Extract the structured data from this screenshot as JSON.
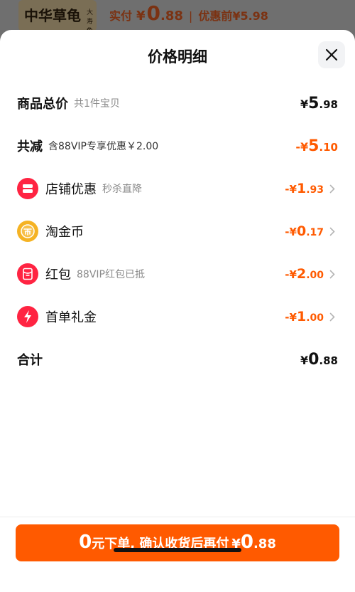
{
  "top_strip": {
    "thumb_title": "中华草龟",
    "thumb_sub": "大寿龟",
    "paid_label": "实付",
    "paid_yen": "¥",
    "paid_int": "0",
    "paid_dec": ".88",
    "separator": "|",
    "before_discount": "优惠前¥5.98"
  },
  "sheet": {
    "title": "价格明细"
  },
  "rows": {
    "total": {
      "label": "商品总价",
      "sub": "共1件宝贝",
      "yen": "¥",
      "int": "5",
      "dec": ".98"
    },
    "reduce": {
      "label": "共减",
      "sub": "含88VIP专享优惠￥2.00",
      "yen": "-¥",
      "int": "5",
      "dec": ".10"
    },
    "shop": {
      "label": "店铺优惠",
      "sub": "秒杀直降",
      "yen": "-¥",
      "int": "1",
      "dec": ".93"
    },
    "coin": {
      "label": "淘金币",
      "sub": "",
      "yen": "-¥",
      "int": "0",
      "dec": ".17"
    },
    "redpacket": {
      "label": "红包",
      "sub": "88VIP红包已抵",
      "yen": "-¥",
      "int": "2",
      "dec": ".00"
    },
    "firstorder": {
      "label": "首单礼金",
      "sub": "",
      "yen": "-¥",
      "int": "1",
      "dec": ".00"
    },
    "sum": {
      "label": "合计",
      "yen": "¥",
      "int": "0",
      "dec": ".88"
    }
  },
  "cta": {
    "big": "0",
    "text": "元下单, 确认收货后再付",
    "yen": "¥",
    "int": "0",
    "dec": ".88"
  },
  "colors": {
    "accent": "#ff5a00",
    "red_icon": "#ff2442",
    "gold_icon": "#f5b324"
  },
  "icons": {
    "close": "close-icon",
    "shop": "shop-coupon-icon",
    "coin": "coin-icon",
    "redpacket": "red-packet-icon",
    "firstorder": "lightning-icon",
    "chevron": "chevron-right-icon"
  }
}
